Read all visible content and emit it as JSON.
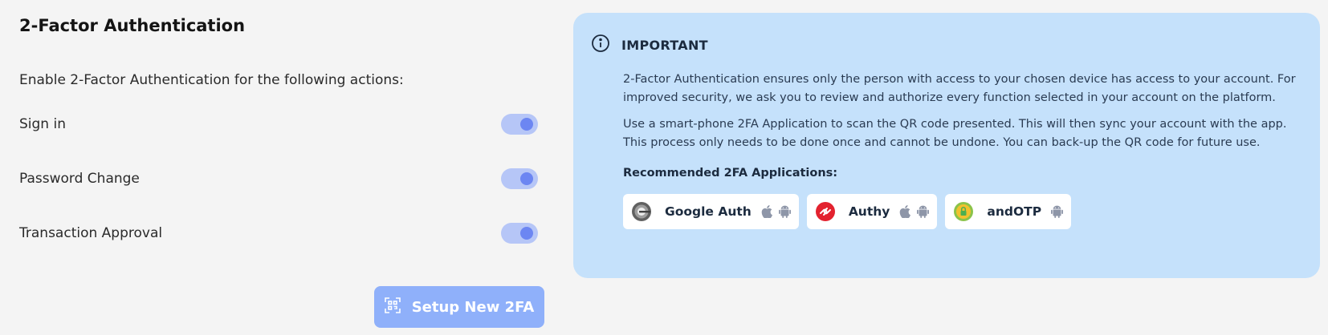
{
  "page": {
    "title": "2-Factor Authentication",
    "intro": "Enable 2-Factor Authentication for the following actions:"
  },
  "options": [
    {
      "label": "Sign in",
      "enabled": true
    },
    {
      "label": "Password Change",
      "enabled": true
    },
    {
      "label": "Transaction Approval",
      "enabled": true
    }
  ],
  "setup_button": {
    "label": "Setup New 2FA",
    "icon": "qr-scan-icon"
  },
  "info": {
    "title": "IMPORTANT",
    "icon": "info-icon",
    "paragraph1": "2-Factor Authentication ensures only the person with access to your chosen device has access to your account. For improved security, we ask you to review and authorize every function selected in your account on the platform.",
    "paragraph2": "Use a smart-phone 2FA Application to scan the QR code presented. This will then sync your account with the app. This process only needs to be done once and cannot be undone. You can back-up the QR code for future use.",
    "recommended_title": "Recommended 2FA Applications:",
    "apps": [
      {
        "name": "Google Auth",
        "logo": "google-authenticator-icon",
        "platforms": [
          "apple",
          "android"
        ]
      },
      {
        "name": "Authy",
        "logo": "authy-icon",
        "platforms": [
          "apple",
          "android"
        ]
      },
      {
        "name": "andOTP",
        "logo": "andotp-icon",
        "platforms": [
          "android"
        ]
      }
    ]
  },
  "colors": {
    "background": "#f4f4f4",
    "panel": "#c5e1fb",
    "toggle_track": "#b6c6f7",
    "toggle_knob": "#6c86f2",
    "button": "#8fb0fa",
    "authy_red": "#e3222f",
    "andotp_green": "#8bc34a"
  }
}
